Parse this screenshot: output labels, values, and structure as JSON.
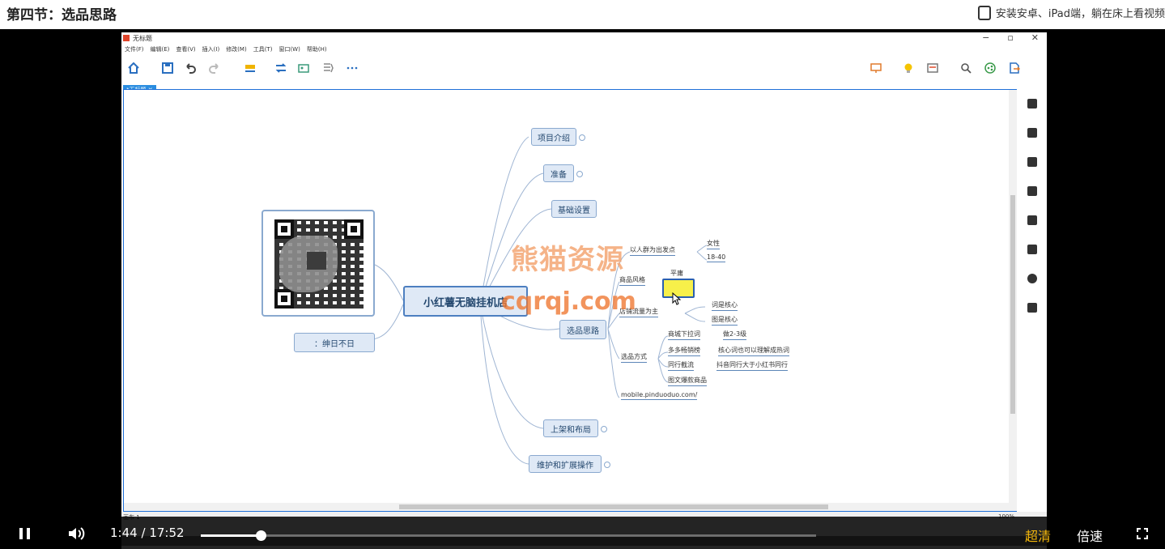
{
  "header": {
    "section_title": "第四节：选品思路",
    "promo_text": "安装安卓、iPad端，躺在床上看视频"
  },
  "window": {
    "title": "无标题",
    "menu": [
      "文件(F)",
      "编辑(E)",
      "查看(V)",
      "插入(I)",
      "修改(M)",
      "工具(T)",
      "窗口(W)",
      "帮助(H)"
    ],
    "controls": [
      "−",
      "▫",
      "✕"
    ],
    "tab_label": "*无标题",
    "tab_close": "✕",
    "status_label": "画布 1",
    "zoom_text": "100%"
  },
  "mindmap": {
    "central": "小红薯无脑挂机店",
    "name_node": "：绅日不日",
    "branches": [
      "项目介绍",
      "准备",
      "基础设置",
      "选品思路",
      "上架和布局",
      "维护和扩展操作"
    ],
    "leaves": {
      "audience": "以人群为出发点",
      "female": "女性",
      "age": "18-40",
      "style": "商品风格",
      "flat": "平庸",
      "traffic": "店铺流量为主",
      "nuclear_a": "词是核心",
      "nuclear_b": "图是核心",
      "mall_dropdown": "商城下拉词",
      "level": "做2-3级",
      "pdd": "多多畅销榜",
      "core_words": "核心词也可以理解成热词",
      "competitor": "同行截流",
      "douyin": "抖音同行大于小红书同行",
      "method": "选品方式",
      "explosive": "图文爆款商品",
      "url": "mobile.pinduoduo.com/"
    }
  },
  "watermark": {
    "line1": "熊猫资源",
    "line2": "cqrqj.com"
  },
  "player": {
    "current_time": "1:44",
    "separator": "/",
    "duration": "17:52",
    "progress": 0.097,
    "quality_label": "超清",
    "speed_label": "倍速",
    "accent_color": "#f5b70a"
  }
}
